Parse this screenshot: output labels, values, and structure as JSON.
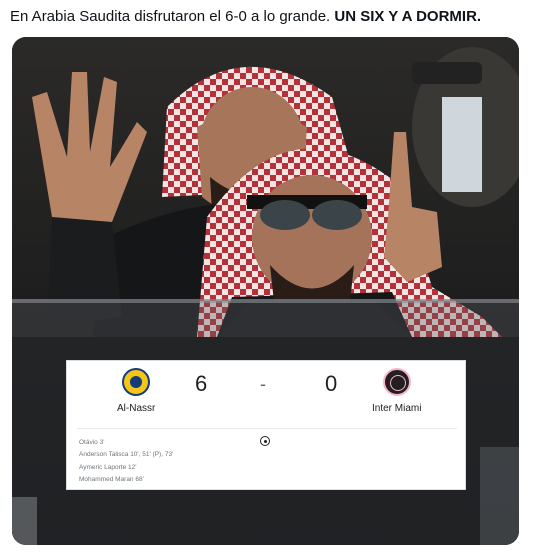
{
  "tweet": {
    "text_plain": "En Arabia Saudita disfrutaron el 6-0 a lo grande. ",
    "text_bold": "UN SIX Y A DORMIR."
  },
  "scorecard": {
    "home_team": "Al-Nassr",
    "away_team": "Inter Miami",
    "home_score": "6",
    "separator": "-",
    "away_score": "0",
    "scorers": [
      "Otávio 3'",
      "Anderson Talisca 10', 51' (P), 73'",
      "Aymeric Laporte 12'",
      "Mohammed Maran 68'"
    ],
    "icons": {
      "home_logo": "al-nassr-crest-icon",
      "away_logo": "inter-miami-crest-icon",
      "goal": "soccer-ball-icon"
    }
  }
}
